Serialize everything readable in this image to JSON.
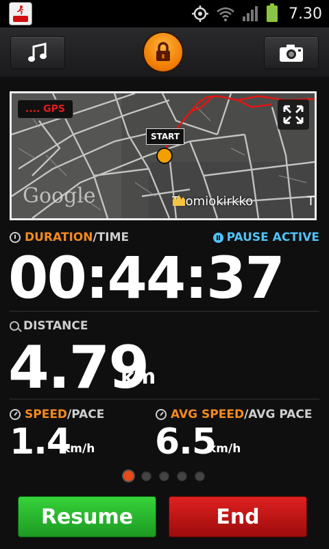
{
  "status_bar": {
    "time": "7.30"
  },
  "toolbar": {
    "music_icon": "music-note-icon",
    "lock_icon": "lock-icon",
    "camera_icon": "camera-icon"
  },
  "map": {
    "gps_label": ".... GPS",
    "start_label": "START",
    "poi_label": "Tuomiokirkko",
    "edge_text": "T",
    "logo_text": "Google"
  },
  "stats": {
    "duration_label_accent": "DURATION",
    "duration_label_rest": "/TIME",
    "pause_label": "PAUSE ACTIVE",
    "duration_value": "00:44:37",
    "distance_label": "DISTANCE",
    "distance_value": "4.79",
    "distance_unit": "km",
    "speed_label_accent": "SPEED",
    "speed_label_rest": "/PACE",
    "speed_value": "1.4",
    "speed_unit": "km/h",
    "avg_label_accent": "AVG SPEED",
    "avg_label_rest": "/AVG PACE",
    "avg_value": "6.5",
    "avg_unit": "km/h"
  },
  "pager": {
    "count": 5,
    "active_index": 0
  },
  "actions": {
    "resume_label": "Resume",
    "end_label": "End"
  },
  "colors": {
    "accent_orange": "#f58a1f",
    "pause_blue": "#4fc3f7",
    "resume_green": "#2cba2f",
    "end_red": "#c41414"
  }
}
